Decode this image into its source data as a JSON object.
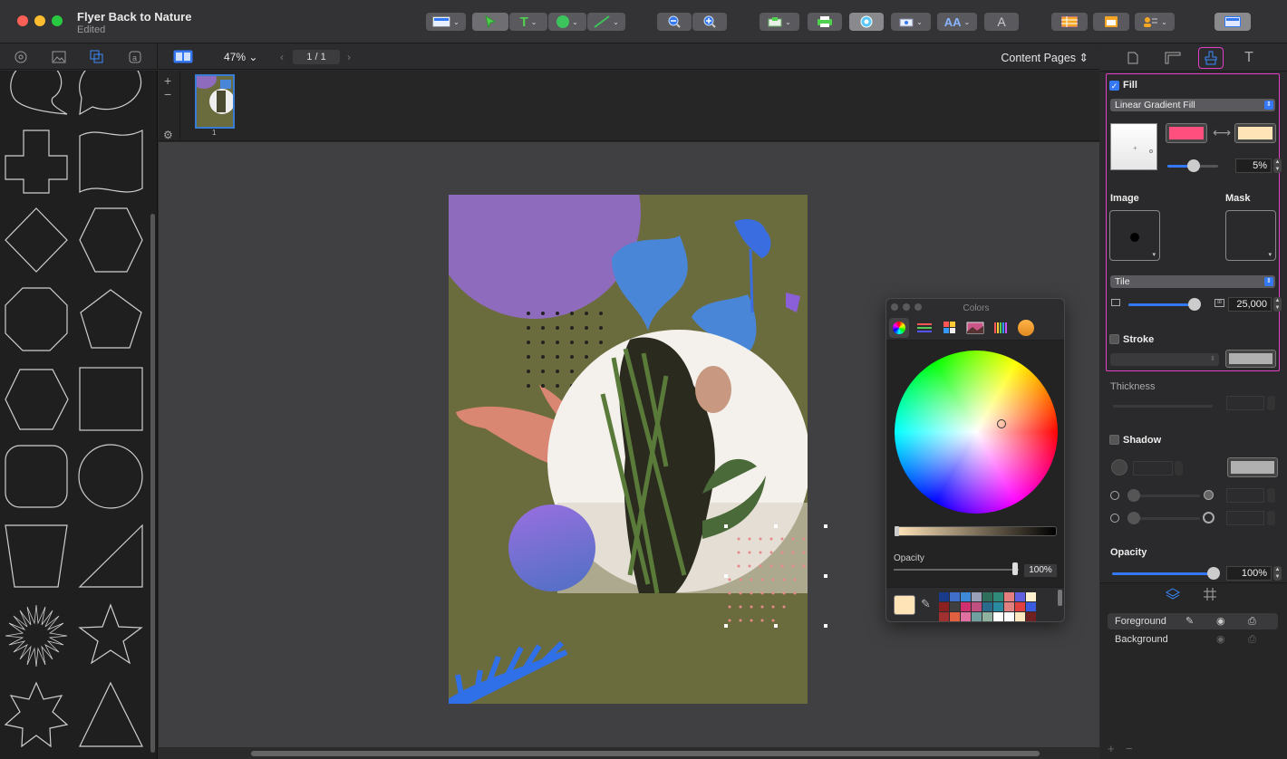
{
  "window": {
    "title": "Flyer Back to Nature",
    "subtitle": "Edited"
  },
  "toolbar": {
    "buttons": [
      "layout-button",
      "select-tool",
      "text-tool",
      "shape-tool",
      "line-tool",
      "zoom-out",
      "zoom-in",
      "insert-button",
      "print-button",
      "preview-button",
      "share-button",
      "font-style-button",
      "typography-button",
      "table-button",
      "calendar-button",
      "contacts-button",
      "sidebar-toggle"
    ]
  },
  "doc_bar": {
    "zoom": "47%",
    "page_indicator": "1 / 1",
    "content_pages": "Content Pages"
  },
  "thumbnail": {
    "page_number": "1"
  },
  "colors_window": {
    "title": "Colors",
    "opacity_label": "Opacity",
    "opacity_value": "100%",
    "current_color": "#FFE4B8",
    "swatches": [
      "#1a3a8a",
      "#3f6fc8",
      "#3f8ad8",
      "#9aa0b8",
      "#2f6e5a",
      "#2f8a7a",
      "#e57f7f",
      "#6060e0",
      "#fff0d0",
      "#8b2020",
      "#3f3f3f",
      "#d0306f",
      "#c05080",
      "#2a6a8a",
      "#2a8aa0",
      "#e08080",
      "#e04040",
      "#3a5ae0",
      "#a03030",
      "#e06040",
      "#e070a0",
      "#70a0a0",
      "#90b0a0",
      "#ffffff",
      "#ffffff",
      "#ffe8c0",
      "#702020"
    ]
  },
  "inspector": {
    "fill": {
      "label": "Fill",
      "checked": true,
      "type": "Linear Gradient Fill",
      "color_start": "#FF4F7E",
      "color_end": "#FFE4B8",
      "angle_value": "5%"
    },
    "image": {
      "label": "Image",
      "mode": "Tile",
      "scale_value": "25,000"
    },
    "mask": {
      "label": "Mask"
    },
    "stroke": {
      "label": "Stroke",
      "checked": false
    },
    "thickness": {
      "label": "Thickness"
    },
    "shadow": {
      "label": "Shadow",
      "checked": false
    },
    "opacity": {
      "label": "Opacity",
      "value": "100%",
      "level": 1.0
    }
  },
  "layers": [
    {
      "name": "Foreground",
      "selected": true
    },
    {
      "name": "Background",
      "selected": false
    }
  ]
}
